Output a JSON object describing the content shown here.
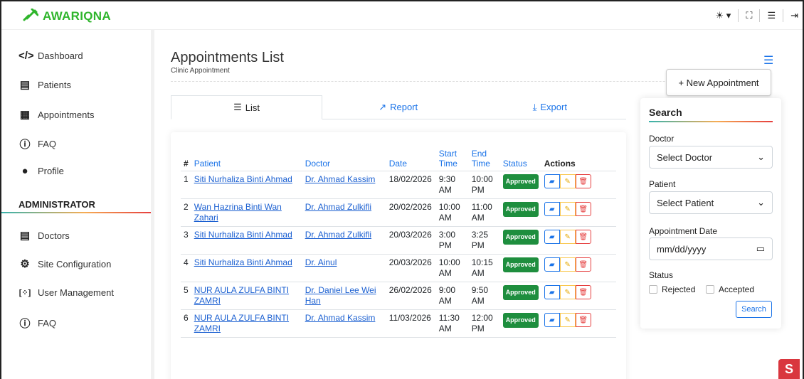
{
  "brand": {
    "name": "AWARIQNA",
    "color": "#2fb52c"
  },
  "topbar": {
    "icons": [
      "sun-icon",
      "fullscreen-icon",
      "menu-collapse-icon",
      "logout-icon"
    ]
  },
  "sidebar": {
    "items": [
      {
        "label": "Dashboard",
        "icon": "code-icon"
      },
      {
        "label": "Patients",
        "icon": "id-card-icon"
      },
      {
        "label": "Appointments",
        "icon": "calendar-icon"
      },
      {
        "label": "FAQ",
        "icon": "question-icon"
      },
      {
        "label": "Profile",
        "icon": "user-icon"
      }
    ],
    "admin_title": "ADMINISTRATOR",
    "admin_items": [
      {
        "label": "Doctors",
        "icon": "id-card-icon"
      },
      {
        "label": "Site Configuration",
        "icon": "gear-icon"
      },
      {
        "label": "User Management",
        "icon": "users-icon"
      },
      {
        "label": "FAQ",
        "icon": "question-icon"
      }
    ]
  },
  "page": {
    "title": "Appointments List",
    "subtitle": "Clinic Appointment"
  },
  "tabs": [
    {
      "label": "List",
      "icon": "list-icon"
    },
    {
      "label": "Report",
      "icon": "chart-icon"
    },
    {
      "label": "Export",
      "icon": "download-icon"
    }
  ],
  "table": {
    "headers": {
      "num": "#",
      "patient": "Patient",
      "doctor": "Doctor",
      "date": "Date",
      "start": "Start Time",
      "end": "End Time",
      "status": "Status",
      "actions": "Actions"
    },
    "rows": [
      {
        "num": "1",
        "patient": "Siti Nurhaliza Binti Ahmad",
        "doctor": "Dr. Ahmad Kassim",
        "date": "18/02/2026",
        "start": "9:30 AM",
        "end": "10:00 PM",
        "status": "Approved"
      },
      {
        "num": "2",
        "patient": "Wan Hazrina Binti Wan Zahari",
        "doctor": "Dr. Ahmad Zulkifli",
        "date": "20/02/2026",
        "start": "10:00 AM",
        "end": "11:00 AM",
        "status": "Approved"
      },
      {
        "num": "3",
        "patient": "Siti Nurhaliza Binti Ahmad",
        "doctor": "Dr. Ahmad Zulkifli",
        "date": "20/03/2026",
        "start": "3:00 PM",
        "end": "3:25 PM",
        "status": "Approved"
      },
      {
        "num": "4",
        "patient": "Siti Nurhaliza Binti Ahmad",
        "doctor": "Dr. Ainul",
        "date": "20/03/2026",
        "start": "10:00 AM",
        "end": "10:15 AM",
        "status": "Approved"
      },
      {
        "num": "5",
        "patient": "NUR AULA ZULFA BINTI ZAMRI",
        "doctor": "Dr. Daniel Lee Wei Han",
        "date": "26/02/2026",
        "start": "9:00 AM",
        "end": "9:50 AM",
        "status": "Approved"
      },
      {
        "num": "6",
        "patient": "NUR AULA ZULFA BINTI ZAMRI",
        "doctor": "Dr. Ahmad Kassim",
        "date": "11/03/2026",
        "start": "11:30 AM",
        "end": "12:00 PM",
        "status": "Approved"
      }
    ]
  },
  "new_button": "+ New Appointment",
  "search": {
    "title": "Search",
    "doctor_label": "Doctor",
    "doctor_value": "Select Doctor",
    "patient_label": "Patient",
    "patient_value": "Select Patient",
    "date_label": "Appointment Date",
    "date_placeholder": "mm/dd/yyyy",
    "status_label": "Status",
    "status_options": [
      "Rejected",
      "Accepted"
    ],
    "button": "Search"
  }
}
